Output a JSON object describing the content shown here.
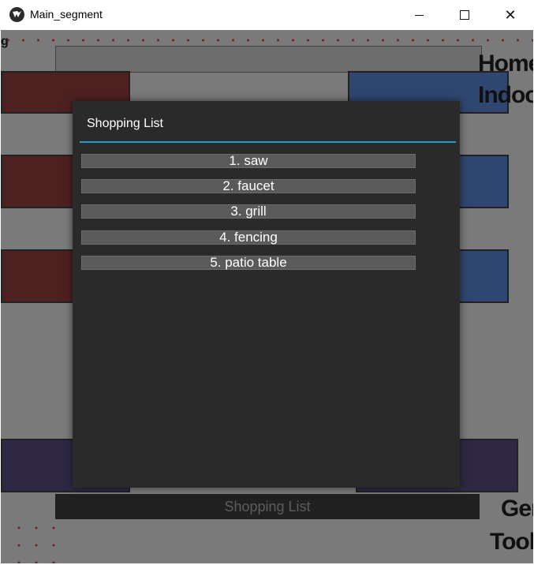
{
  "window": {
    "title": "Main_segment",
    "icon": "kivy-logo-icon",
    "controls": [
      "minimize-icon",
      "maximize-icon",
      "close-icon"
    ]
  },
  "background": {
    "label_top_right_1": "Home I",
    "label_top_right_2": "Indoor",
    "label_bottom_right_1": "Gen",
    "label_bottom_right_2": "Tools",
    "fragment_left": "g",
    "bottom_button": "Shopping List",
    "colors": {
      "red": "#4e2121",
      "blue": "#2f4770",
      "purple": "#2e2844"
    }
  },
  "popup": {
    "title": "Shopping List",
    "accent": "#1e9fd0",
    "items": [
      {
        "label": "1. saw"
      },
      {
        "label": "2. faucet"
      },
      {
        "label": "3. grill"
      },
      {
        "label": "4. fencing"
      },
      {
        "label": "5. patio table"
      }
    ]
  }
}
